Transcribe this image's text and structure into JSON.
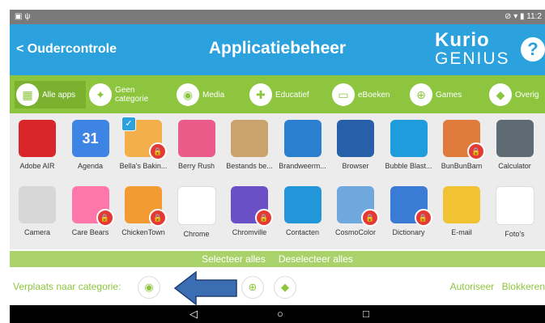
{
  "status": {
    "left": "▣ ψ",
    "right": "⊘ ▾ ▮ 11:2"
  },
  "header": {
    "back_label": "< Oudercontrole",
    "title": "Applicatiebeheer",
    "logo_line1": "Kurio",
    "logo_line2": "GENIUS",
    "help": "?"
  },
  "categories": [
    {
      "label": "Alle apps",
      "icon": "grid-icon"
    },
    {
      "label": "Geen categorie",
      "icon": "puzzle-icon"
    },
    {
      "label": "Media",
      "icon": "eye-icon"
    },
    {
      "label": "Educatief",
      "icon": "puzzle-piece-icon"
    },
    {
      "label": "eBoeken",
      "icon": "book-icon"
    },
    {
      "label": "Games",
      "icon": "gamepad-icon"
    },
    {
      "label": "Overig",
      "icon": "tag-icon"
    }
  ],
  "apps_row1": [
    {
      "name": "Adobe AIR",
      "color": "#d9262b"
    },
    {
      "name": "Agenda",
      "color": "#3d84e5",
      "glyph": "31"
    },
    {
      "name": "Bella's Bakin...",
      "color": "#f3b04a",
      "locked": true,
      "checked": true
    },
    {
      "name": "Berry Rush",
      "color": "#ea5b8a"
    },
    {
      "name": "Bestands be...",
      "color": "#c9a36b"
    },
    {
      "name": "Brandweerm...",
      "color": "#2a7fcf"
    },
    {
      "name": "Browser",
      "color": "#275fa8"
    },
    {
      "name": "Bubble Blast...",
      "color": "#1f9cdc"
    },
    {
      "name": "BunBunBam",
      "color": "#e07b3c",
      "locked": true
    },
    {
      "name": "Calculator",
      "color": "#5f6b73"
    }
  ],
  "apps_row2": [
    {
      "name": "Camera",
      "color": "#d7d7d7"
    },
    {
      "name": "Care Bears",
      "color": "#ff77a8",
      "locked": true
    },
    {
      "name": "ChickenTown",
      "color": "#f29b32",
      "locked": true
    },
    {
      "name": "Chrome",
      "color": "#ffffff"
    },
    {
      "name": "Chromville",
      "color": "#6b4fc7",
      "locked": true
    },
    {
      "name": "Contacten",
      "color": "#2196d9"
    },
    {
      "name": "CosmoColor",
      "color": "#6fa8dc",
      "locked": true
    },
    {
      "name": "Dictionary",
      "color": "#3a7bd5",
      "locked": true
    },
    {
      "name": "E-mail",
      "color": "#f1c232"
    },
    {
      "name": "Foto's",
      "color": "#ffffff"
    }
  ],
  "select_all": "Selecteer alles",
  "deselect_all": "Deselecteer alles",
  "move_label": "Verplaats naar categorie:",
  "move_icons": [
    "eye-icon",
    "gamepad-icon",
    "tag-icon"
  ],
  "authorize": "Autoriseer",
  "block": "Blokkeren",
  "nav": {
    "back": "◁",
    "home": "○",
    "recent": "□"
  },
  "colors": {
    "header": "#2ba2de",
    "category_bar": "#8dc53e",
    "lock": "#e53935",
    "arrow": "#3b6db3"
  }
}
